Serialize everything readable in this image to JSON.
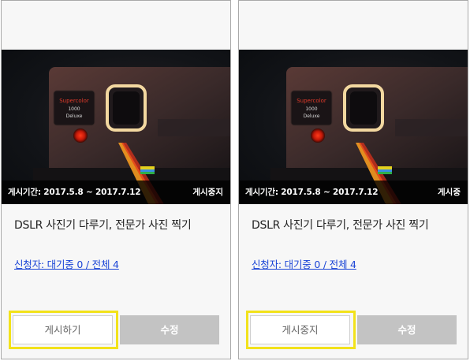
{
  "cards": [
    {
      "period": "게시기간: 2017.5.8 ~ 2017.7.12",
      "status": "게시중지",
      "title": "DSLR 사진기 다루기, 전문가 사진 찍기",
      "applicants": "신청자: 대기중 0 / 전체 4",
      "primary_button": "게시하기",
      "edit_button": "수정"
    },
    {
      "period": "게시기간: 2017.5.8 ~ 2017.7.12",
      "status": "게시중",
      "title": "DSLR 사진기 다루기, 전문가 사진 찍기",
      "applicants": "신청자: 대기중 0 / 전체 4",
      "primary_button": "게시중지",
      "edit_button": "수정"
    }
  ],
  "camera_label": {
    "brand": "Supercolor",
    "model": "1000",
    "edition": "Deluxe"
  },
  "colors": {
    "highlight": "#f2e21b",
    "link": "#1a44d6",
    "edit_button_bg": "#c3c3c3"
  }
}
